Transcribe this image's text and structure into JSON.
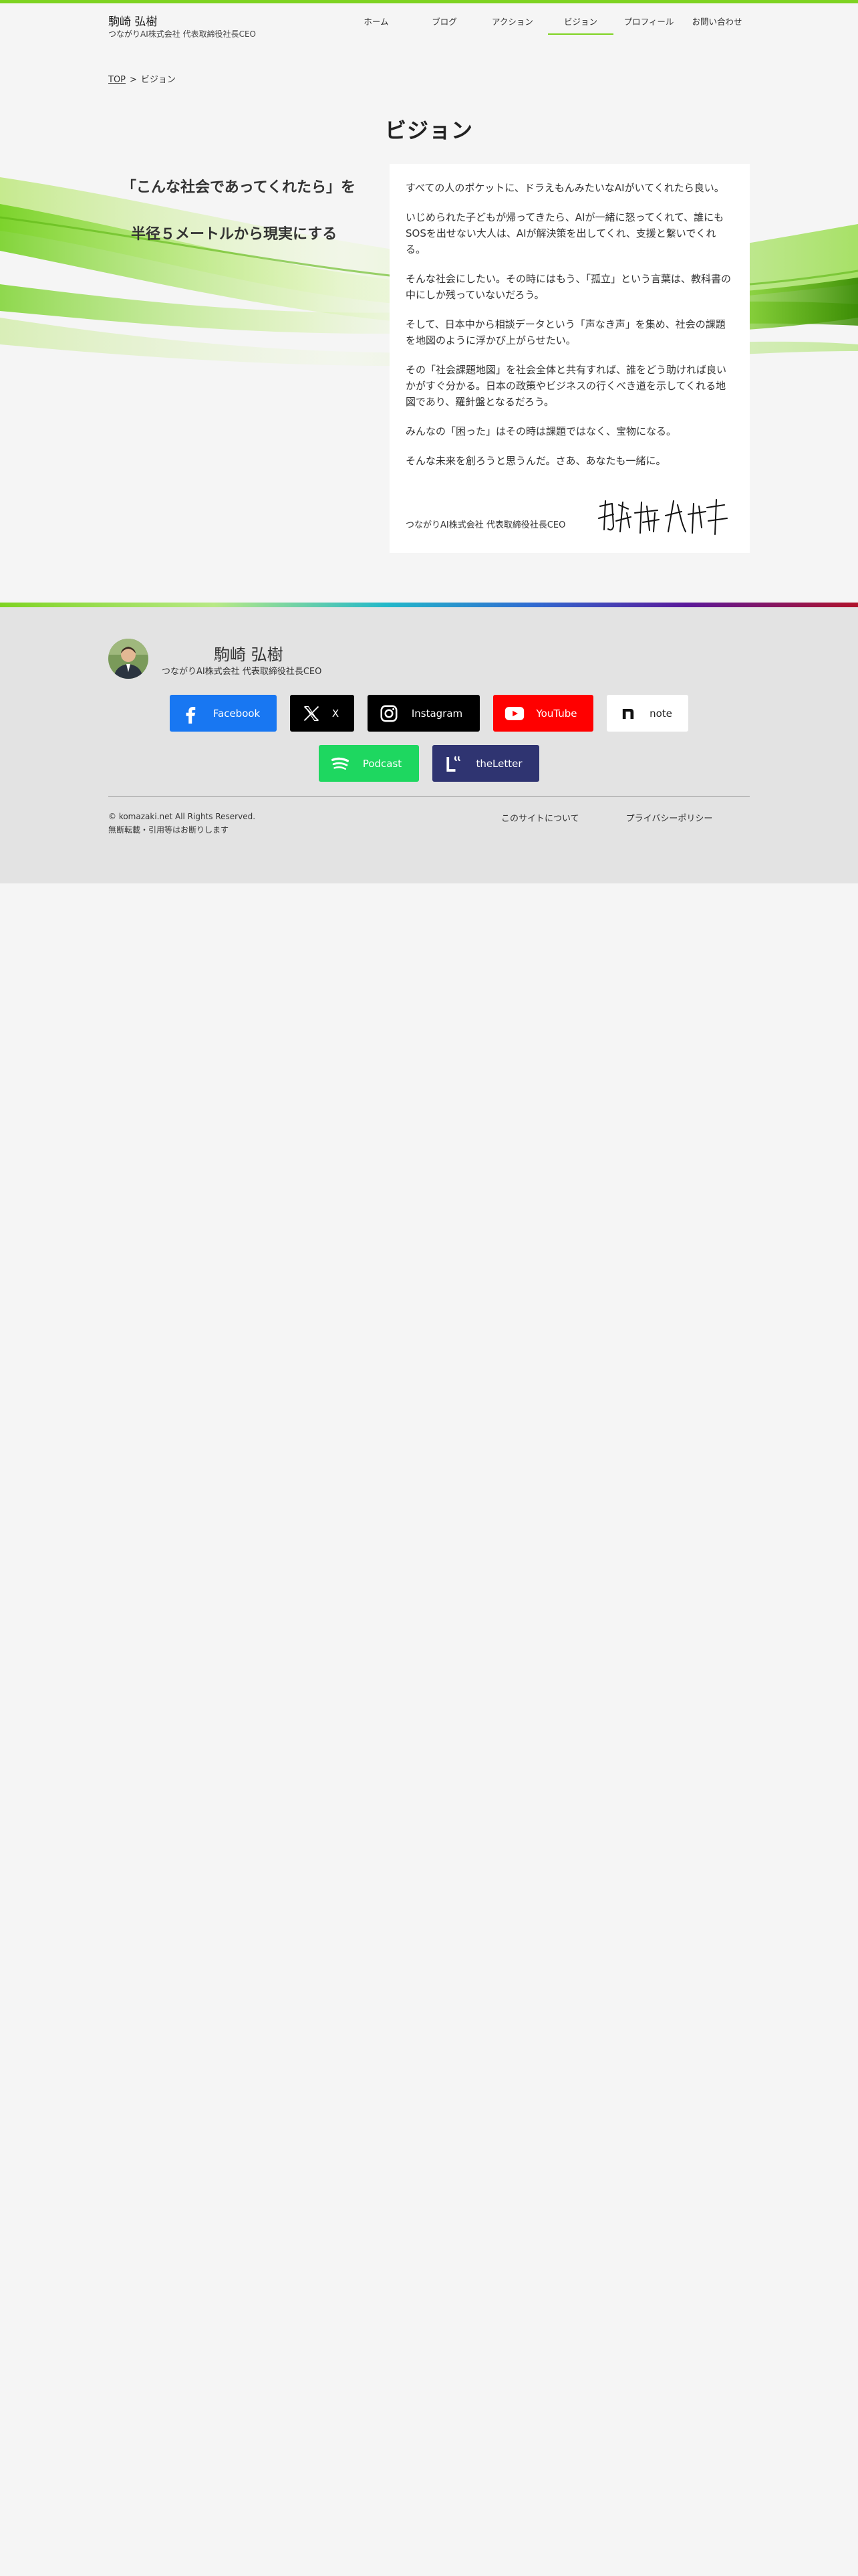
{
  "header": {
    "name": "駒崎 弘樹",
    "subtitle": "つながりAI株式会社 代表取締役社長CEO",
    "nav": [
      {
        "label": "ホーム"
      },
      {
        "label": "ブログ"
      },
      {
        "label": "アクション"
      },
      {
        "label": "ビジョン",
        "active": true
      },
      {
        "label": "プロフィール"
      },
      {
        "label": "お問い合わせ"
      }
    ]
  },
  "breadcrumb": {
    "home": "TOP",
    "separator": ">",
    "current": "ビジョン"
  },
  "page_title": "ビジョン",
  "motto": {
    "line1": "「こんな社会であってくれたら」を",
    "line2": "半径５メートルから現実にする"
  },
  "vision": {
    "paragraphs": [
      "すべての人のポケットに、ドラえもんみたいなAIがいてくれたら良い。",
      "いじめられた子どもが帰ってきたら、AIが一緒に怒ってくれて、誰にもSOSを出せない大人は、AIが解決策を出してくれ、支援と繋いでくれる。",
      "そんな社会にしたい。その時にはもう、「孤立」という言葉は、教科書の中にしか残っていないだろう。",
      "そして、日本中から相談データという「声なき声」を集め、社会の課題を地図のように浮かび上がらせたい。",
      "その「社会課題地図」を社会全体と共有すれば、誰をどう助ければ良いかがすぐ分かる。日本の政策やビジネスの行くべき道を示してくれる地図であり、羅針盤となるだろう。",
      "みんなの「困った」はその時は課題ではなく、宝物になる。",
      "そんな未来を創ろうと思うんだ。さあ、あなたも一緒に。"
    ],
    "signature_label": "つながりAI株式会社 代表取締役社長CEO"
  },
  "footer": {
    "profile_name": "駒崎 弘樹",
    "profile_role": "つながりAI株式会社 代表取締役社長CEO",
    "social_row1": [
      {
        "label": "Facebook",
        "icon": "facebook-icon"
      },
      {
        "label": "X",
        "icon": "x-icon"
      },
      {
        "label": "Instagram",
        "icon": "instagram-icon"
      },
      {
        "label": "YouTube",
        "icon": "youtube-icon"
      },
      {
        "label": "note",
        "icon": "note-icon"
      }
    ],
    "social_row2": [
      {
        "label": "Podcast",
        "icon": "spotify-icon"
      },
      {
        "label": "theLetter",
        "icon": "theletter-icon"
      }
    ],
    "copyright_line1": "© komazaki.net All Rights Reserved.",
    "copyright_line2": "無断転載・引用等はお断りします",
    "links": [
      {
        "label": "このサイトについて"
      },
      {
        "label": "プライバシーポリシー"
      }
    ]
  },
  "colors": {
    "accent": "#7ed321",
    "facebook": "#1877f2",
    "youtube": "#ff0000",
    "podcast": "#1ed760",
    "theletter": "#2f3471"
  }
}
